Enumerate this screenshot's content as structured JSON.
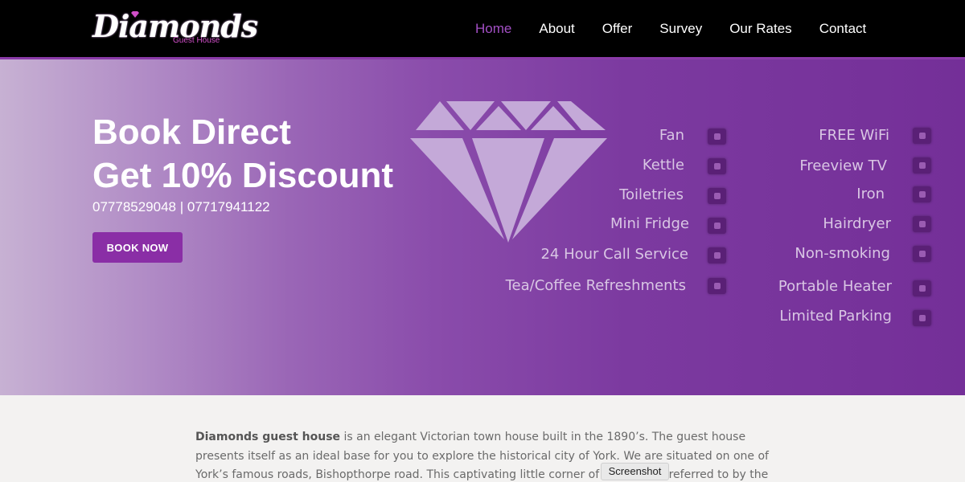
{
  "logo": {
    "main": "Diamonds",
    "sub": "Guest House"
  },
  "nav": {
    "items": [
      {
        "label": "Home",
        "active": true
      },
      {
        "label": "About",
        "active": false
      },
      {
        "label": "Offer",
        "active": false
      },
      {
        "label": "Survey",
        "active": false
      },
      {
        "label": "Our Rates",
        "active": false
      },
      {
        "label": "Contact",
        "active": false
      }
    ]
  },
  "hero": {
    "title_line1": "Book Direct",
    "title_line2": "Get 10% Discount",
    "phones": "07778529048 | 07717941122",
    "book_button": "BOOK NOW",
    "amenities_left": [
      "Fan",
      "Kettle",
      "Toiletries",
      "Mini Fridge",
      "24 Hour Call Service",
      "Tea/Coffee Refreshments"
    ],
    "amenities_right": [
      "FREE WiFi",
      "Freeview TV",
      "Iron",
      "Hairdryer",
      "Non-smoking",
      "Portable Heater",
      "Limited Parking"
    ]
  },
  "intro": {
    "brand": "Diamonds guest house",
    "text": " is an elegant Victorian town house built in the 1890’s. The guest house presents itself as an ideal base for you to explore the historical city of York. We are situated on one of York’s famous roads, Bishopthorpe road. This captivating little corner of York is also referred to by the locals who know and love it as"
  },
  "tooltip": "Screenshot",
  "colors": {
    "accent": "#8a2ea6",
    "nav_active": "#a24fc4",
    "header": "#000000"
  }
}
